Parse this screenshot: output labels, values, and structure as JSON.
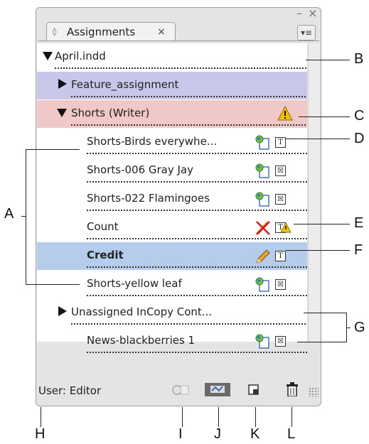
{
  "panel": {
    "tab_label": "Assignments",
    "tab_close": "×",
    "minimize": "–",
    "close": "×",
    "menu_glyph": "▾≡"
  },
  "rows": [
    {
      "label": "April.indd"
    },
    {
      "label": "Feature_assignment"
    },
    {
      "label": "Shorts (Writer)"
    },
    {
      "label": "Shorts-Birds everywhe..."
    },
    {
      "label": "Shorts-006 Gray Jay"
    },
    {
      "label": "Shorts-022 Flamingoes"
    },
    {
      "label": "Count"
    },
    {
      "label": "Credit"
    },
    {
      "label": "Shorts-yellow leaf"
    },
    {
      "label": "Unassigned InCopy Cont..."
    },
    {
      "label": "News-blackberries 1"
    }
  ],
  "footer": {
    "user_label": "User: Editor"
  },
  "callouts": {
    "A": "A",
    "B": "B",
    "C": "C",
    "D": "D",
    "E": "E",
    "F": "F",
    "G": "G",
    "H": "H",
    "I": "I",
    "J": "J",
    "K": "K",
    "L": "L"
  },
  "icons": {
    "t_text": "T",
    "x_text": "☒"
  },
  "colors": {
    "purple_row": "#c8c7ea",
    "pink_row": "#f0c8c8",
    "blue_row": "#b5cdea",
    "warning": "#f2c200"
  }
}
